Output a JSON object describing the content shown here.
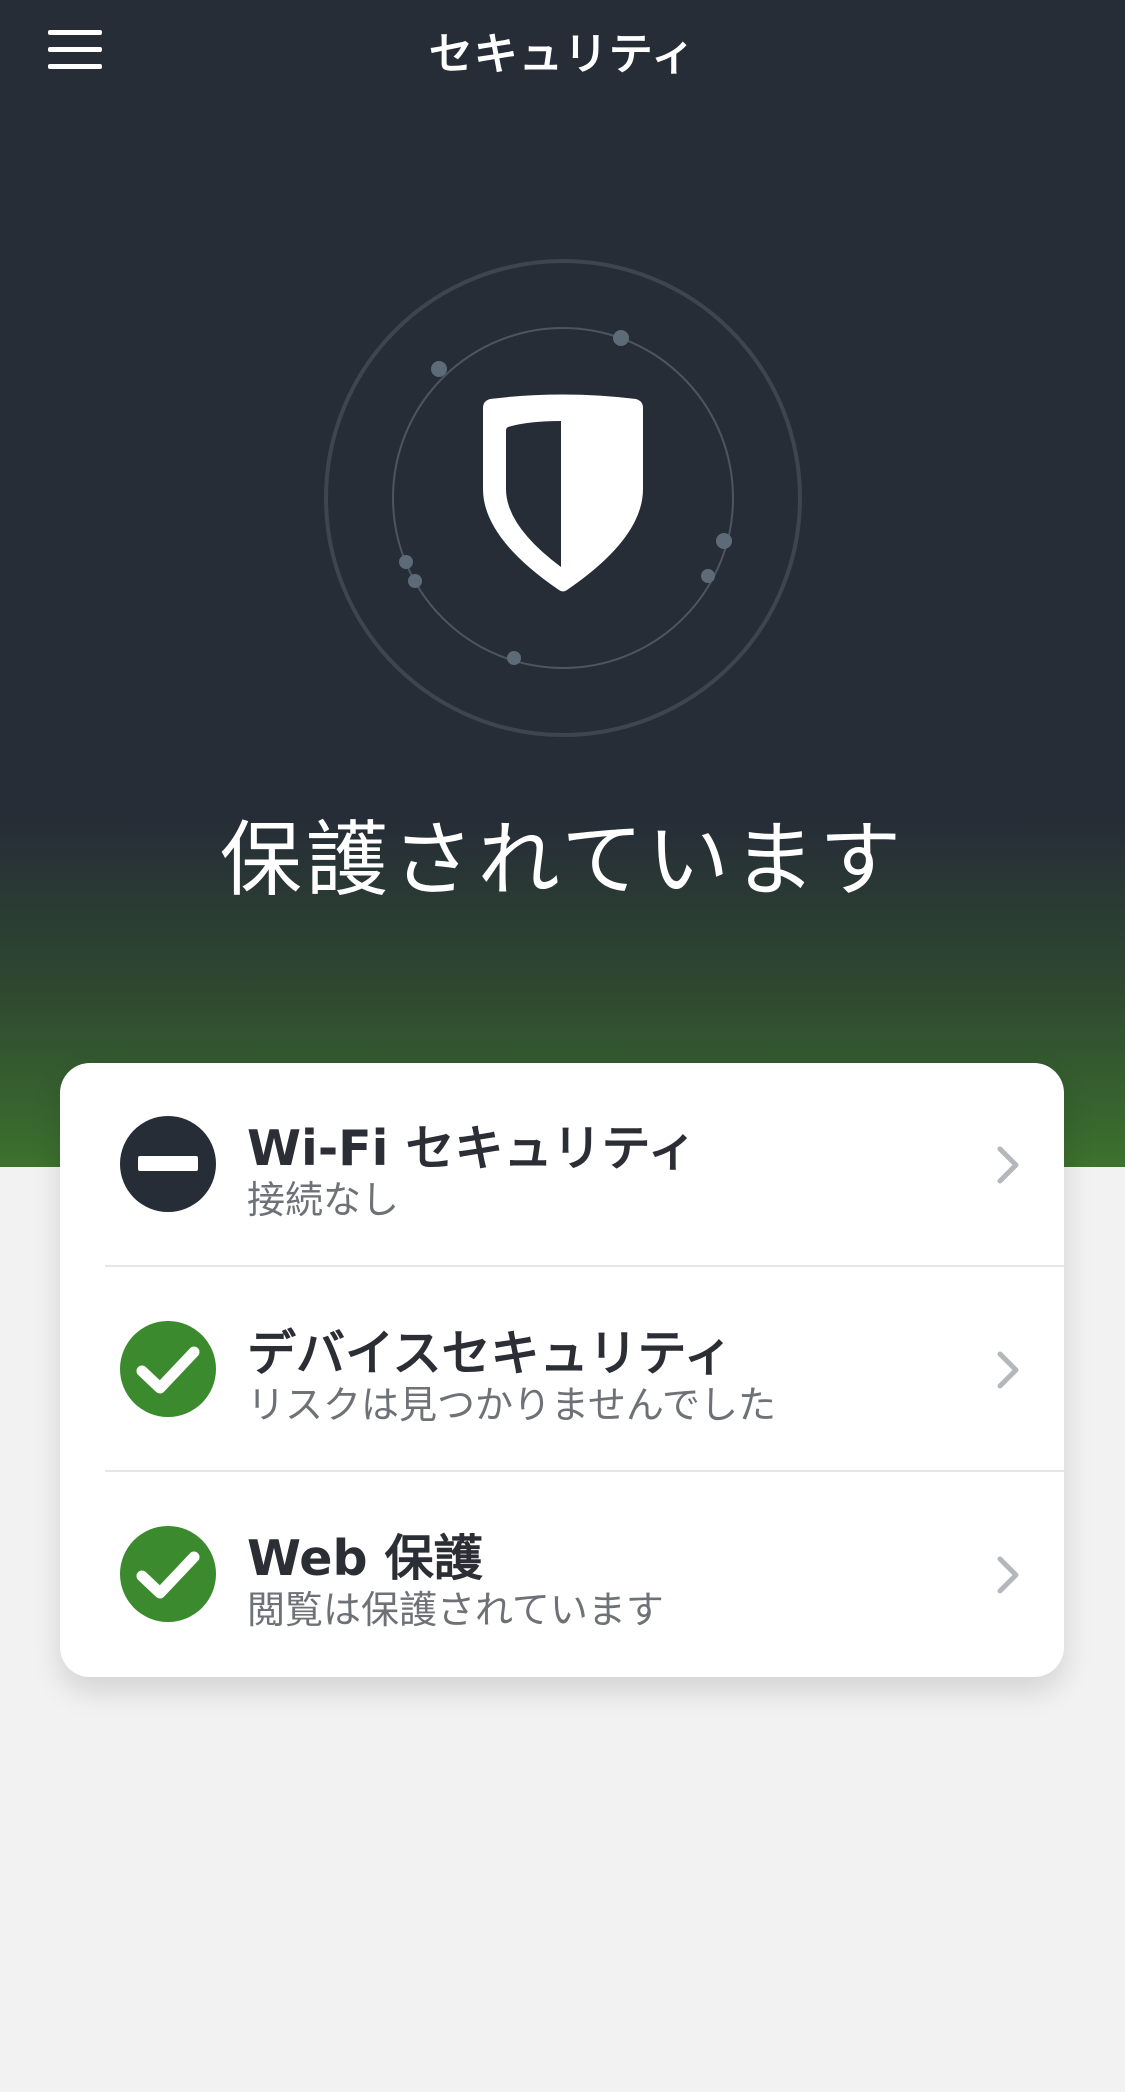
{
  "app": {
    "title": "セキュリティ"
  },
  "header": {
    "menu_icon": "hamburger-menu-icon"
  },
  "hero": {
    "icon": "shield-icon",
    "status_text": "保護されています"
  },
  "colors": {
    "background_dark": "#262d37",
    "accent_green": "#3c8a2e",
    "hero_gradient_end": "#3c722e",
    "card_bg": "#ffffff",
    "page_bg": "#f2f2f2"
  },
  "security_items": [
    {
      "title": "Wi-Fi セキュリティ",
      "subtitle": "接続なし",
      "status": "none",
      "status_icon": "minus-circle-icon"
    },
    {
      "title": "デバイスセキュリティ",
      "subtitle": "リスクは見つかりませんでした",
      "status": "ok",
      "status_icon": "check-circle-icon"
    },
    {
      "title": "Web 保護",
      "subtitle": "閲覧は保護されています",
      "status": "ok",
      "status_icon": "check-circle-icon"
    }
  ]
}
